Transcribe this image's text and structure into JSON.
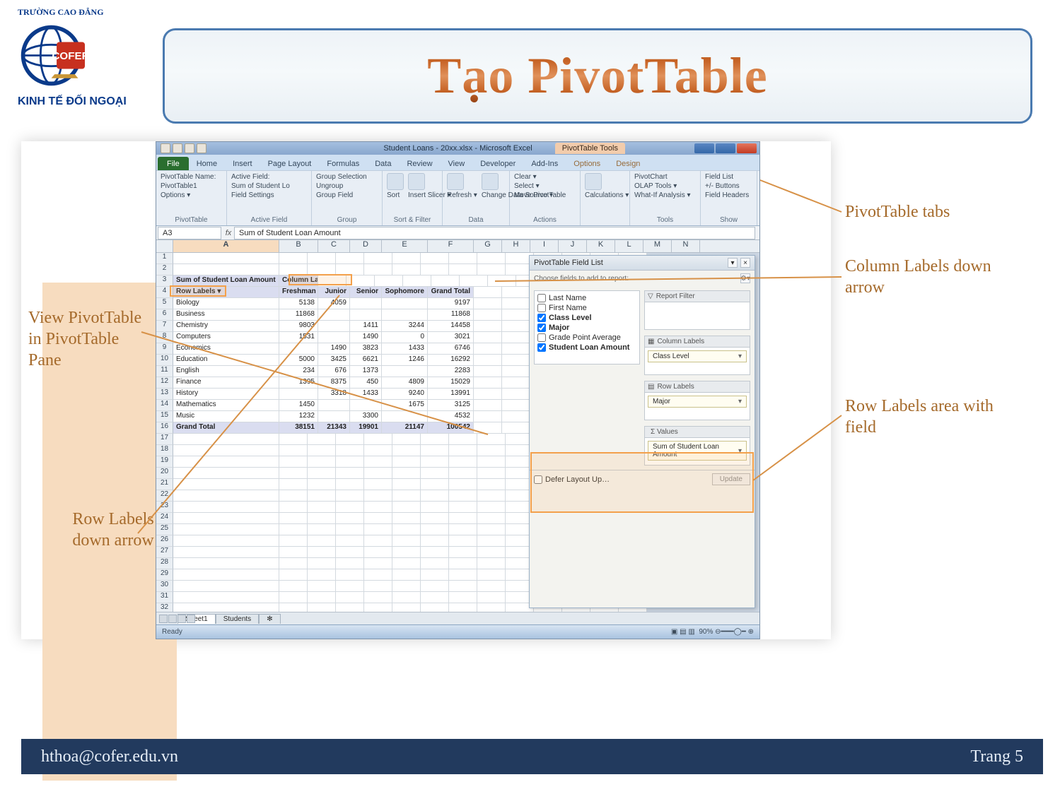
{
  "slide": {
    "title": "Tạo PivotTable",
    "logo_top": "TRƯỜNG CAO ĐẲNG",
    "logo_brand": "COFER",
    "logo_bottom": "KINH TẾ ĐỐI NGOẠI",
    "footer_email": "hthoa@cofer.edu.vn",
    "page_label": "Trang 5"
  },
  "callouts": {
    "tabs": "PivotTable tabs",
    "col_arrow": "Column Labels down arrow",
    "view_in_pane": "View PivotTable in PivotTable Pane",
    "row_area": "Row Labels area with field",
    "row_arrow": "Row Labels down arrow"
  },
  "excel": {
    "document": "Student Loans - 20xx.xlsx - Microsoft Excel",
    "contextual": "PivotTable Tools",
    "tabs": [
      "File",
      "Home",
      "Insert",
      "Page Layout",
      "Formulas",
      "Data",
      "Review",
      "View",
      "Developer",
      "Add-Ins",
      "Options",
      "Design"
    ],
    "ribbon": {
      "pivottable_label": "PivotTable Name:",
      "pivottable_name": "PivotTable1",
      "options_btn": "Options ▾",
      "grp_pt": "PivotTable",
      "active_label": "Active Field:",
      "active_name": "Sum of Student Lo",
      "field_settings": "Field Settings",
      "grp_af": "Active Field",
      "group_sel": "Group Selection",
      "ungroup": "Ungroup",
      "group_field": "Group Field",
      "grp_group": "Group",
      "sort": "Sort",
      "insert_slicer": "Insert Slicer ▾",
      "grp_sort": "Sort & Filter",
      "refresh": "Refresh ▾",
      "change_src": "Change Data Source ▾",
      "grp_data": "Data",
      "clear": "Clear ▾",
      "select": "Select ▾",
      "move": "Move PivotTable",
      "grp_actions": "Actions",
      "calc": "Calculations ▾",
      "pivotchart": "PivotChart",
      "olap": "OLAP Tools ▾",
      "whatif": "What-If Analysis ▾",
      "grp_tools": "Tools",
      "fieldlist": "Field List",
      "plusminus": "+/- Buttons",
      "fieldhdr": "Field Headers",
      "grp_show": "Show"
    },
    "namebox": "A3",
    "formula": "Sum of Student Loan Amount",
    "cols": [
      "A",
      "B",
      "C",
      "D",
      "E",
      "F",
      "G",
      "H",
      "I",
      "J",
      "K",
      "L",
      "M",
      "N"
    ],
    "col_labels_text": "Column Labels",
    "row_labels_text": "Row Labels",
    "class_levels": [
      "Freshman",
      "Junior",
      "Senior",
      "Sophomore",
      "Grand Total"
    ],
    "a3": "Sum of Student Loan Amount",
    "majors": [
      {
        "n": "Biology",
        "v": [
          5138,
          4059,
          "",
          "",
          9197
        ]
      },
      {
        "n": "Business",
        "v": [
          11868,
          "",
          "",
          "",
          11868
        ]
      },
      {
        "n": "Chemistry",
        "v": [
          9803,
          "",
          1411,
          3244,
          14458
        ]
      },
      {
        "n": "Computers",
        "v": [
          1531,
          "",
          1490,
          0,
          3021
        ]
      },
      {
        "n": "Economics",
        "v": [
          "",
          1490,
          3823,
          1433,
          6746
        ]
      },
      {
        "n": "Education",
        "v": [
          5000,
          3425,
          6621,
          1246,
          16292
        ]
      },
      {
        "n": "English",
        "v": [
          234,
          676,
          1373,
          "",
          2283
        ]
      },
      {
        "n": "Finance",
        "v": [
          1395,
          8375,
          450,
          4809,
          15029
        ]
      },
      {
        "n": "History",
        "v": [
          "",
          3318,
          1433,
          9240,
          13991
        ]
      },
      {
        "n": "Mathematics",
        "v": [
          1450,
          "",
          "",
          1675,
          3125
        ]
      },
      {
        "n": "Music",
        "v": [
          1232,
          "",
          3300,
          "",
          4532
        ]
      }
    ],
    "grand_total_label": "Grand Total",
    "grand_total": [
      38151,
      21343,
      19901,
      21147,
      100542
    ],
    "fieldlist": {
      "title": "PivotTable Field List",
      "choose": "Choose fields to add to report:",
      "fields": [
        {
          "label": "Last Name",
          "checked": false
        },
        {
          "label": "First Name",
          "checked": false
        },
        {
          "label": "Class Level",
          "checked": true
        },
        {
          "label": "Major",
          "checked": true
        },
        {
          "label": "Grade Point Average",
          "checked": false
        },
        {
          "label": "Student Loan Amount",
          "checked": true
        }
      ],
      "q_report": "Report Filter",
      "q_col": "Column Labels",
      "q_row": "Row Labels",
      "q_val": "Σ  Values",
      "col_item": "Class Level",
      "row_item": "Major",
      "val_item": "Sum of Student Loan Amount",
      "defer": "Defer Layout Up…",
      "update": "Update"
    },
    "sheet_tabs": [
      "Sheet1",
      "Students"
    ],
    "status_ready": "Ready",
    "zoom": "90%"
  }
}
